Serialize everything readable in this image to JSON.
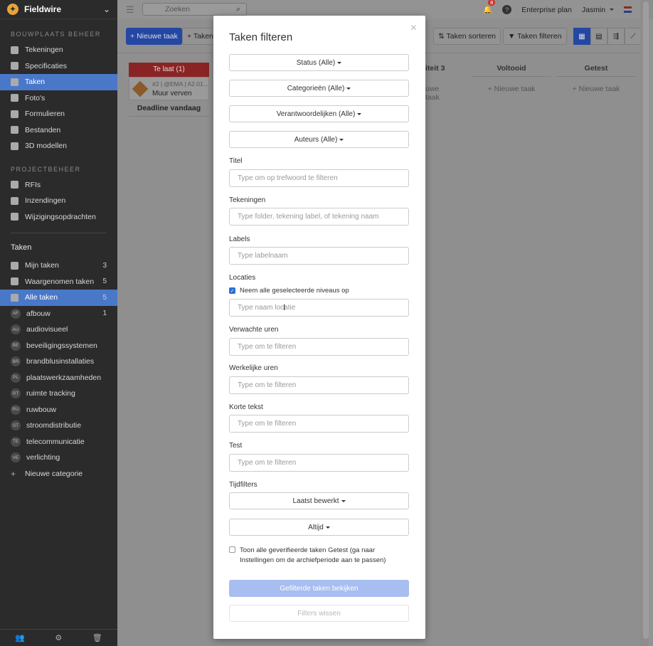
{
  "app": {
    "brand": "Fieldwire",
    "logo_glyph": "✦"
  },
  "sidebar": {
    "section_site": "BOUWPLAATS BEHEER",
    "site_items": [
      {
        "label": "Tekeningen",
        "icon": "drawings-icon"
      },
      {
        "label": "Specificaties",
        "icon": "specs-icon"
      },
      {
        "label": "Taken",
        "icon": "tasks-list-icon",
        "active": true
      },
      {
        "label": "Foto's",
        "icon": "camera-icon"
      },
      {
        "label": "Formulieren",
        "icon": "forms-icon"
      },
      {
        "label": "Bestanden",
        "icon": "paperclip-icon"
      },
      {
        "label": "3D modellen",
        "icon": "cube-icon"
      }
    ],
    "section_project": "PROJECTBEHEER",
    "project_items": [
      {
        "label": "RFIs",
        "icon": "rfi-icon"
      },
      {
        "label": "Inzendingen",
        "icon": "submittals-icon"
      },
      {
        "label": "Wijzigingsopdrachten",
        "icon": "change-orders-icon"
      }
    ],
    "section_tasks": "Taken",
    "task_items": [
      {
        "label": "Mijn taken",
        "count": "3"
      },
      {
        "label": "Waargenomen taken",
        "count": "5"
      },
      {
        "label": "Alle taken",
        "count": "5"
      }
    ],
    "categories": [
      {
        "abbr": "AF",
        "label": "afbouw",
        "count": "1"
      },
      {
        "abbr": "AU",
        "label": "audiovisueel",
        "count": ""
      },
      {
        "abbr": "BE",
        "label": "beveiligingssystemen",
        "count": ""
      },
      {
        "abbr": "BR",
        "label": "brandblusinstallaties",
        "count": ""
      },
      {
        "abbr": "PL",
        "label": "plaatswerkzaamheden",
        "count": ""
      },
      {
        "abbr": "RT",
        "label": "ruimte tracking",
        "count": ""
      },
      {
        "abbr": "RU",
        "label": "ruwbouw",
        "count": ""
      },
      {
        "abbr": "ST",
        "label": "stroomdistributie",
        "count": ""
      },
      {
        "abbr": "TE",
        "label": "telecommunicatie",
        "count": ""
      },
      {
        "abbr": "VE",
        "label": "verlichting",
        "count": ""
      }
    ],
    "new_category": "Nieuwe categorie"
  },
  "topbar": {
    "search_placeholder": "Zoeken",
    "notifications_count": "8",
    "plan": "Enterprise plan",
    "user": "Jasmin"
  },
  "toolbar": {
    "new_task": "Nieuwe taak",
    "taken_partial": "Taken i",
    "sort": "Taken sorteren",
    "filter": "Taken filteren"
  },
  "board": {
    "late_label": "Te laat",
    "late_count": "(1)",
    "card_meta": "#2 | @EMA | A2.01...",
    "card_title": "Muur verven",
    "deadline_label": "Deadline vandaag",
    "columns": [
      {
        "title": "iteit 3",
        "new": "uwe taak"
      },
      {
        "title": "Voltooid",
        "new": "+ Nieuwe taak"
      },
      {
        "title": "Getest",
        "new": "+ Nieuwe taak"
      }
    ]
  },
  "modal": {
    "title": "Taken filteren",
    "close": "×",
    "dropdowns": {
      "status": "Status (Alle)",
      "categories": "Categorieën (Alle)",
      "assignees": "Verantwoordelijken (Alle)",
      "authors": "Auteurs (Alle)"
    },
    "fields": {
      "title_label": "Titel",
      "title_placeholder": "Type om op trefwoord te filteren",
      "drawings_label": "Tekeningen",
      "drawings_placeholder": "Type folder, tekening label, of tekening naam",
      "labels_label": "Labels",
      "labels_placeholder": "Type labelnaam",
      "locations_label": "Locaties",
      "include_levels": "Neem alle geselecteerde niveaus op",
      "locations_placeholder": "Type naam locatie",
      "expected_hours_label": "Verwachte uren",
      "expected_hours_placeholder": "Type om te filteren",
      "actual_hours_label": "Werkelijke uren",
      "actual_hours_placeholder": "Type om te filteren",
      "short_text_label": "Korte tekst",
      "short_text_placeholder": "Type om te filteren",
      "test_label": "Test",
      "test_placeholder": "Type om te filteren",
      "time_filters_label": "Tijdfilters",
      "last_edited": "Laatst bewerkt",
      "always": "Altijd"
    },
    "verified_checkbox": "Toon alle geverifieerde taken Getest (ga naar Instellingen om de archiefperiode aan te passen)",
    "apply_button": "Gefilterde taken bekijken",
    "clear_button": "Filters wissen"
  }
}
